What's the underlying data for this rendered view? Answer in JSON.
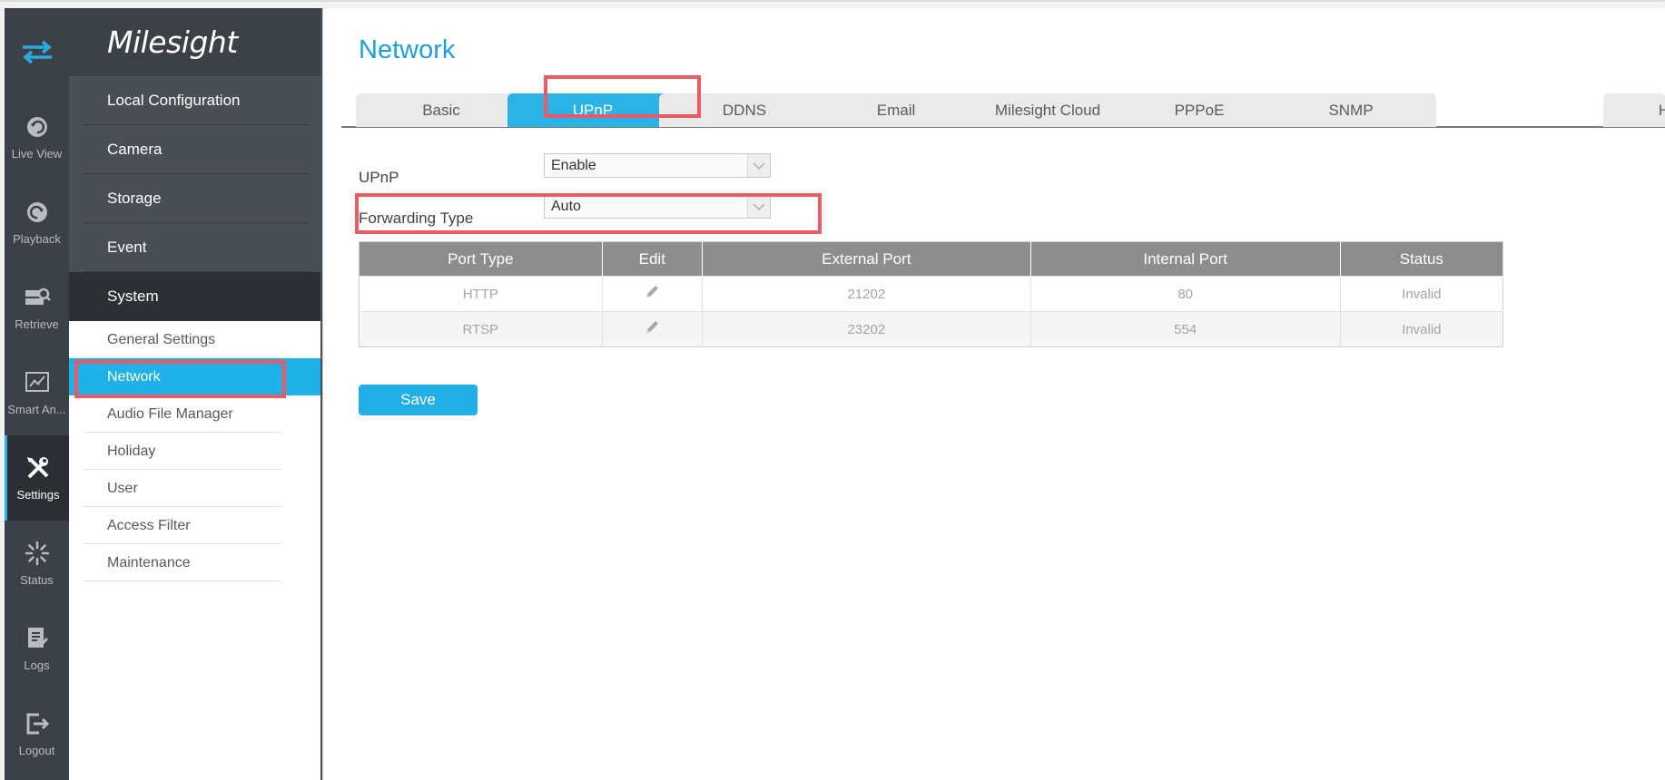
{
  "app": {
    "logo_text": "Milesight"
  },
  "rail": {
    "items": [
      {
        "label": "Live View",
        "icon": "live-view-icon"
      },
      {
        "label": "Playback",
        "icon": "playback-icon"
      },
      {
        "label": "Retrieve",
        "icon": "retrieve-icon"
      },
      {
        "label": "Smart An...",
        "icon": "smart-analytics-icon"
      },
      {
        "label": "Settings",
        "icon": "settings-icon"
      },
      {
        "label": "Status",
        "icon": "status-icon"
      },
      {
        "label": "Logs",
        "icon": "logs-icon"
      },
      {
        "label": "Logout",
        "icon": "logout-icon"
      }
    ],
    "active": "Settings"
  },
  "menu": {
    "categories": [
      "Local Configuration",
      "Camera",
      "Storage",
      "Event",
      "System"
    ],
    "open_category": "System",
    "sub_items": [
      "General Settings",
      "Network",
      "Audio File Manager",
      "Holiday",
      "User",
      "Access Filter",
      "Maintenance"
    ],
    "active_sub": "Network"
  },
  "page": {
    "title": "Network",
    "tabs": [
      "Basic",
      "UPnP",
      "DDNS",
      "Email",
      "Milesight Cloud",
      "PPPoE",
      "SNMP",
      "H"
    ],
    "active_tab": "UPnP"
  },
  "form": {
    "upnp_label": "UPnP",
    "upnp_value": "Enable",
    "forwarding_label": "Forwarding Type",
    "forwarding_value": "Auto"
  },
  "table": {
    "headers": [
      "Port Type",
      "Edit",
      "External Port",
      "Internal Port",
      "Status"
    ],
    "rows": [
      {
        "port_type": "HTTP",
        "external": "21202",
        "internal": "80",
        "status": "Invalid"
      },
      {
        "port_type": "RTSP",
        "external": "23202",
        "internal": "554",
        "status": "Invalid"
      }
    ]
  },
  "actions": {
    "save_label": "Save"
  },
  "colors": {
    "accent": "#2bb3e6",
    "highlight": "#ee5a64",
    "rail_bg": "#3c4147"
  }
}
